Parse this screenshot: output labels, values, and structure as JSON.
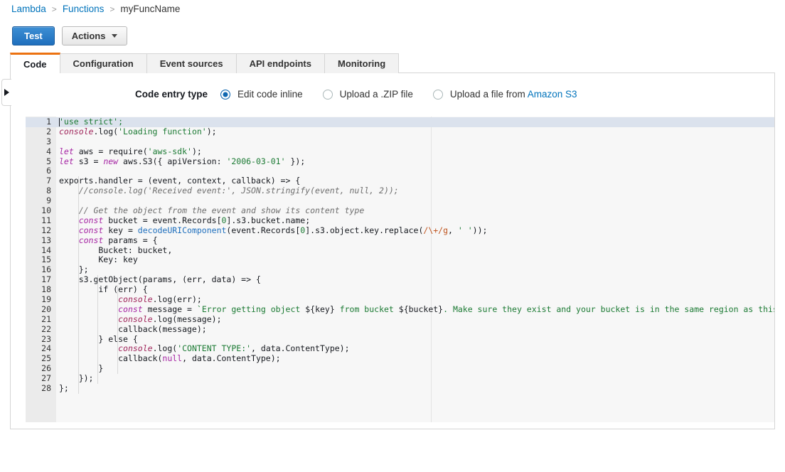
{
  "breadcrumb": {
    "items": [
      {
        "label": "Lambda",
        "link": true
      },
      {
        "label": "Functions",
        "link": true
      },
      {
        "label": "myFuncName",
        "link": false
      }
    ],
    "separator": ">"
  },
  "toolbar": {
    "test_label": "Test",
    "actions_label": "Actions"
  },
  "tabs": [
    {
      "label": "Code",
      "active": true
    },
    {
      "label": "Configuration",
      "active": false
    },
    {
      "label": "Event sources",
      "active": false
    },
    {
      "label": "API endpoints",
      "active": false
    },
    {
      "label": "Monitoring",
      "active": false
    }
  ],
  "code_entry": {
    "label": "Code entry type",
    "options": [
      {
        "label": "Edit code inline",
        "selected": true
      },
      {
        "label": "Upload a .ZIP file",
        "selected": false
      },
      {
        "label": "Upload a file from ",
        "link_label": "Amazon S3",
        "selected": false
      }
    ]
  },
  "editor": {
    "active_line": 1,
    "total_lines": 28,
    "language": "javascript",
    "lines": [
      {
        "n": 1,
        "tokens": [
          {
            "t": "'use strict';",
            "c": "t-str"
          }
        ]
      },
      {
        "n": 2,
        "tokens": [
          {
            "t": "console",
            "c": "t-ident"
          },
          {
            "t": ".log(",
            "c": "t-txt"
          },
          {
            "t": "'Loading function'",
            "c": "t-str"
          },
          {
            "t": ");",
            "c": "t-txt"
          }
        ]
      },
      {
        "n": 3,
        "tokens": []
      },
      {
        "n": 4,
        "tokens": [
          {
            "t": "let",
            "c": "t-kw"
          },
          {
            "t": " aws = require(",
            "c": "t-txt"
          },
          {
            "t": "'aws-sdk'",
            "c": "t-str"
          },
          {
            "t": ");",
            "c": "t-txt"
          }
        ]
      },
      {
        "n": 5,
        "tokens": [
          {
            "t": "let",
            "c": "t-kw"
          },
          {
            "t": " s3 = ",
            "c": "t-txt"
          },
          {
            "t": "new",
            "c": "t-kw"
          },
          {
            "t": " aws.S3({ apiVersion: ",
            "c": "t-txt"
          },
          {
            "t": "'2006-03-01'",
            "c": "t-str"
          },
          {
            "t": " });",
            "c": "t-txt"
          }
        ]
      },
      {
        "n": 6,
        "tokens": []
      },
      {
        "n": 7,
        "tokens": [
          {
            "t": "exports.handler = (event, context, callback) => {",
            "c": "t-txt"
          }
        ]
      },
      {
        "n": 8,
        "tokens": [
          {
            "t": "    //console.log('Received event:', JSON.stringify(event, null, 2));",
            "c": "t-cmt"
          }
        ]
      },
      {
        "n": 9,
        "tokens": []
      },
      {
        "n": 10,
        "tokens": [
          {
            "t": "    // Get the object from the event and show its content type",
            "c": "t-cmt"
          }
        ]
      },
      {
        "n": 11,
        "tokens": [
          {
            "t": "    ",
            "c": "t-txt"
          },
          {
            "t": "const",
            "c": "t-kw"
          },
          {
            "t": " bucket = event.Records[",
            "c": "t-txt"
          },
          {
            "t": "0",
            "c": "t-num"
          },
          {
            "t": "].s3.bucket.name;",
            "c": "t-txt"
          }
        ]
      },
      {
        "n": 12,
        "tokens": [
          {
            "t": "    ",
            "c": "t-txt"
          },
          {
            "t": "const",
            "c": "t-kw"
          },
          {
            "t": " key = ",
            "c": "t-txt"
          },
          {
            "t": "decodeURIComponent",
            "c": "t-fn"
          },
          {
            "t": "(event.Records[",
            "c": "t-txt"
          },
          {
            "t": "0",
            "c": "t-num"
          },
          {
            "t": "].s3.object.key.replace(",
            "c": "t-txt"
          },
          {
            "t": "/\\+/g",
            "c": "t-regex"
          },
          {
            "t": ", ",
            "c": "t-txt"
          },
          {
            "t": "' '",
            "c": "t-str"
          },
          {
            "t": "));",
            "c": "t-txt"
          }
        ]
      },
      {
        "n": 13,
        "tokens": [
          {
            "t": "    ",
            "c": "t-txt"
          },
          {
            "t": "const",
            "c": "t-kw"
          },
          {
            "t": " params = {",
            "c": "t-txt"
          }
        ]
      },
      {
        "n": 14,
        "tokens": [
          {
            "t": "        Bucket: bucket,",
            "c": "t-txt"
          }
        ]
      },
      {
        "n": 15,
        "tokens": [
          {
            "t": "        Key: key",
            "c": "t-txt"
          }
        ]
      },
      {
        "n": 16,
        "tokens": [
          {
            "t": "    };",
            "c": "t-txt"
          }
        ]
      },
      {
        "n": 17,
        "tokens": [
          {
            "t": "    s3.getObject(params, (err, data) => {",
            "c": "t-txt"
          }
        ]
      },
      {
        "n": 18,
        "tokens": [
          {
            "t": "        if (err) {",
            "c": "t-txt"
          }
        ]
      },
      {
        "n": 19,
        "tokens": [
          {
            "t": "            ",
            "c": "t-txt"
          },
          {
            "t": "console",
            "c": "t-ident"
          },
          {
            "t": ".log(err);",
            "c": "t-txt"
          }
        ]
      },
      {
        "n": 20,
        "tokens": [
          {
            "t": "            ",
            "c": "t-txt"
          },
          {
            "t": "const",
            "c": "t-kw"
          },
          {
            "t": " message = ",
            "c": "t-txt"
          },
          {
            "t": "`Error getting object ",
            "c": "t-str"
          },
          {
            "t": "${key}",
            "c": "t-txt"
          },
          {
            "t": " from bucket ",
            "c": "t-str"
          },
          {
            "t": "${bucket}",
            "c": "t-txt"
          },
          {
            "t": ". Make sure they exist and your bucket is in the same region as this function.`",
            "c": "t-str"
          },
          {
            "t": ";",
            "c": "t-txt"
          }
        ]
      },
      {
        "n": 21,
        "tokens": [
          {
            "t": "            ",
            "c": "t-txt"
          },
          {
            "t": "console",
            "c": "t-ident"
          },
          {
            "t": ".log(message);",
            "c": "t-txt"
          }
        ]
      },
      {
        "n": 22,
        "tokens": [
          {
            "t": "            callback(message);",
            "c": "t-txt"
          }
        ]
      },
      {
        "n": 23,
        "tokens": [
          {
            "t": "        } else {",
            "c": "t-txt"
          }
        ]
      },
      {
        "n": 24,
        "tokens": [
          {
            "t": "            ",
            "c": "t-txt"
          },
          {
            "t": "console",
            "c": "t-ident"
          },
          {
            "t": ".log(",
            "c": "t-txt"
          },
          {
            "t": "'CONTENT TYPE:'",
            "c": "t-str"
          },
          {
            "t": ", data.ContentType);",
            "c": "t-txt"
          }
        ]
      },
      {
        "n": 25,
        "tokens": [
          {
            "t": "            callback(",
            "c": "t-txt"
          },
          {
            "t": "null",
            "c": "t-null"
          },
          {
            "t": ", data.ContentType);",
            "c": "t-txt"
          }
        ]
      },
      {
        "n": 26,
        "tokens": [
          {
            "t": "        }",
            "c": "t-txt"
          }
        ]
      },
      {
        "n": 27,
        "tokens": [
          {
            "t": "    });",
            "c": "t-txt"
          }
        ]
      },
      {
        "n": 28,
        "tokens": [
          {
            "t": "};",
            "c": "t-txt"
          }
        ]
      }
    ]
  },
  "colors": {
    "accent_orange": "#ec7211",
    "link_blue": "#0073bb",
    "primary_blue": "#1f6fbd",
    "active_line": "#dbe2ed",
    "gutter_bg": "#ebebeb",
    "editor_bg": "#f7f7f7"
  }
}
